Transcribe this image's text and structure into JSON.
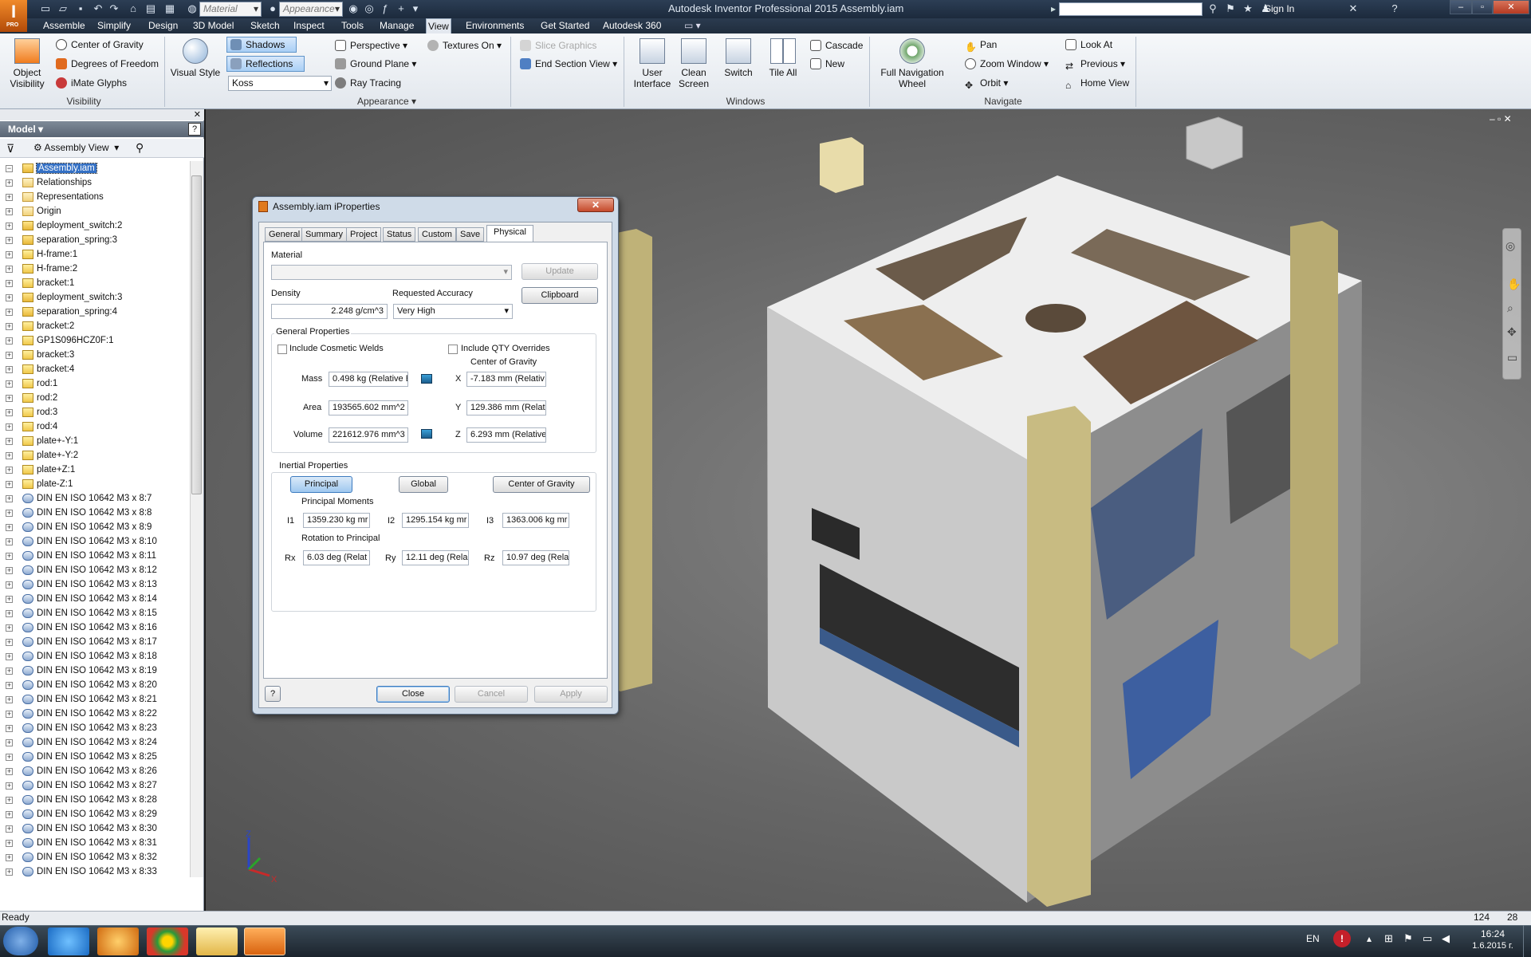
{
  "title_bar": {
    "logo": "I",
    "logo_sub": "PRO",
    "material_combo": "Material",
    "appearance_combo": "Appearance",
    "window_title": "Autodesk Inventor Professional 2015    Assembly.iam",
    "sign_in": "Sign In"
  },
  "menu_tabs": [
    "Assemble",
    "Simplify",
    "Design",
    "3D Model",
    "Sketch",
    "Inspect",
    "Tools",
    "Manage",
    "View",
    "Environments",
    "Get Started",
    "Autodesk 360"
  ],
  "active_tab": "View",
  "ribbon": {
    "visibility": {
      "object_visibility": "Object\nVisibility",
      "center_of_gravity": "Center of Gravity",
      "degrees_of_freedom": "Degrees of Freedom",
      "imate_glyphs": "iMate Glyphs",
      "title": "Visibility"
    },
    "appearance": {
      "visual_style": "Visual Style",
      "shadows": "Shadows",
      "reflections": "Reflections",
      "koss": "Koss",
      "perspective": "Perspective",
      "ground_plane": "Ground Plane",
      "ray_tracing": "Ray Tracing",
      "textures_on": "Textures On",
      "slice_graphics": "Slice Graphics",
      "end_section_view": "End Section View",
      "title": "Appearance"
    },
    "windows": {
      "user_interface": "User\nInterface",
      "clean_screen": "Clean\nScreen",
      "switch": "Switch",
      "tile_all": "Tile All",
      "cascade": "Cascade",
      "new": "New",
      "title": "Windows"
    },
    "navigate": {
      "full_nav_wheel": "Full Navigation\nWheel",
      "pan": "Pan",
      "zoom_window": "Zoom Window",
      "orbit": "Orbit",
      "look_at": "Look At",
      "previous": "Previous",
      "home_view": "Home View",
      "title": "Navigate"
    }
  },
  "browser": {
    "header": "Model",
    "view_combo": "Assembly View",
    "items": [
      {
        "label": "Assembly.iam",
        "type": "asm",
        "selected": true
      },
      {
        "label": "Relationships",
        "type": "folder"
      },
      {
        "label": "Representations",
        "type": "folder"
      },
      {
        "label": "Origin",
        "type": "folder"
      },
      {
        "label": "deployment_switch:2",
        "type": "asm"
      },
      {
        "label": "separation_spring:3",
        "type": "asm"
      },
      {
        "label": "H-frame:1",
        "type": "part"
      },
      {
        "label": "H-frame:2",
        "type": "part"
      },
      {
        "label": "bracket:1",
        "type": "part"
      },
      {
        "label": "deployment_switch:3",
        "type": "asm"
      },
      {
        "label": "separation_spring:4",
        "type": "asm"
      },
      {
        "label": "bracket:2",
        "type": "part"
      },
      {
        "label": "GP1S096HCZ0F:1",
        "type": "part"
      },
      {
        "label": "bracket:3",
        "type": "part"
      },
      {
        "label": "bracket:4",
        "type": "part"
      },
      {
        "label": "rod:1",
        "type": "part"
      },
      {
        "label": "rod:2",
        "type": "part"
      },
      {
        "label": "rod:3",
        "type": "part"
      },
      {
        "label": "rod:4",
        "type": "part"
      },
      {
        "label": "plate+-Y:1",
        "type": "part"
      },
      {
        "label": "plate+-Y:2",
        "type": "part"
      },
      {
        "label": "plate+Z:1",
        "type": "part"
      },
      {
        "label": "plate-Z:1",
        "type": "part"
      },
      {
        "label": "DIN EN ISO 10642 M3 x 8:7",
        "type": "bolt"
      },
      {
        "label": "DIN EN ISO 10642 M3 x 8:8",
        "type": "bolt"
      },
      {
        "label": "DIN EN ISO 10642 M3 x 8:9",
        "type": "bolt"
      },
      {
        "label": "DIN EN ISO 10642 M3 x 8:10",
        "type": "bolt"
      },
      {
        "label": "DIN EN ISO 10642 M3 x 8:11",
        "type": "bolt"
      },
      {
        "label": "DIN EN ISO 10642 M3 x 8:12",
        "type": "bolt"
      },
      {
        "label": "DIN EN ISO 10642 M3 x 8:13",
        "type": "bolt"
      },
      {
        "label": "DIN EN ISO 10642 M3 x 8:14",
        "type": "bolt"
      },
      {
        "label": "DIN EN ISO 10642 M3 x 8:15",
        "type": "bolt"
      },
      {
        "label": "DIN EN ISO 10642 M3 x 8:16",
        "type": "bolt"
      },
      {
        "label": "DIN EN ISO 10642 M3 x 8:17",
        "type": "bolt"
      },
      {
        "label": "DIN EN ISO 10642 M3 x 8:18",
        "type": "bolt"
      },
      {
        "label": "DIN EN ISO 10642 M3 x 8:19",
        "type": "bolt"
      },
      {
        "label": "DIN EN ISO 10642 M3 x 8:20",
        "type": "bolt"
      },
      {
        "label": "DIN EN ISO 10642 M3 x 8:21",
        "type": "bolt"
      },
      {
        "label": "DIN EN ISO 10642 M3 x 8:22",
        "type": "bolt"
      },
      {
        "label": "DIN EN ISO 10642 M3 x 8:23",
        "type": "bolt"
      },
      {
        "label": "DIN EN ISO 10642 M3 x 8:24",
        "type": "bolt"
      },
      {
        "label": "DIN EN ISO 10642 M3 x 8:25",
        "type": "bolt"
      },
      {
        "label": "DIN EN ISO 10642 M3 x 8:26",
        "type": "bolt"
      },
      {
        "label": "DIN EN ISO 10642 M3 x 8:27",
        "type": "bolt"
      },
      {
        "label": "DIN EN ISO 10642 M3 x 8:28",
        "type": "bolt"
      },
      {
        "label": "DIN EN ISO 10642 M3 x 8:29",
        "type": "bolt"
      },
      {
        "label": "DIN EN ISO 10642 M3 x 8:30",
        "type": "bolt"
      },
      {
        "label": "DIN EN ISO 10642 M3 x 8:31",
        "type": "bolt"
      },
      {
        "label": "DIN EN ISO 10642 M3 x 8:32",
        "type": "bolt"
      },
      {
        "label": "DIN EN ISO 10642 M3 x 8:33",
        "type": "bolt"
      }
    ]
  },
  "dialog": {
    "title": "Assembly.iam iProperties",
    "tabs": [
      "General",
      "Summary",
      "Project",
      "Status",
      "Custom",
      "Save",
      "Physical"
    ],
    "active_tab": "Physical",
    "material_label": "Material",
    "material_value": "",
    "update": "Update",
    "density_label": "Density",
    "density_value": "2.248 g/cm^3",
    "accuracy_label": "Requested Accuracy",
    "accuracy_value": "Very High",
    "clipboard": "Clipboard",
    "general_props": "General Properties",
    "include_welds": "Include Cosmetic Welds",
    "include_qty": "Include QTY Overrides",
    "cog_label": "Center of Gravity",
    "mass_label": "Mass",
    "mass_value": "0.498 kg (Relative E",
    "area_label": "Area",
    "area_value": "193565.602 mm^2",
    "volume_label": "Volume",
    "volume_value": "221612.976 mm^3",
    "x_label": "X",
    "x_value": "-7.183 mm (Relativ",
    "y_label": "Y",
    "y_value": "129.386 mm (Relati",
    "z_label": "Z",
    "z_value": "6.293 mm (Relative",
    "inertial_props": "Inertial Properties",
    "principal": "Principal",
    "global": "Global",
    "cog_btn": "Center of Gravity",
    "principal_moments": "Principal Moments",
    "i1_label": "I1",
    "i1_value": "1359.230 kg mr",
    "i2_label": "I2",
    "i2_value": "1295.154 kg mr",
    "i3_label": "I3",
    "i3_value": "1363.006 kg mr",
    "rotation_label": "Rotation to Principal",
    "rx_label": "Rx",
    "rx_value": "6.03 deg (Relat",
    "ry_label": "Ry",
    "ry_value": "12.11 deg (Rela",
    "rz_label": "Rz",
    "rz_value": "10.97 deg (Rela",
    "help": "?",
    "close": "Close",
    "cancel": "Cancel",
    "apply": "Apply"
  },
  "statusbar": {
    "text": "Ready",
    "count1": "124",
    "count2": "28"
  },
  "taskbar": {
    "lang": "EN",
    "time": "16:24",
    "date": "1.6.2015 г."
  },
  "colors": {
    "accent": "#3470c4",
    "frame_rod": "#c8b880",
    "panel_white": "#f2f2f2"
  }
}
